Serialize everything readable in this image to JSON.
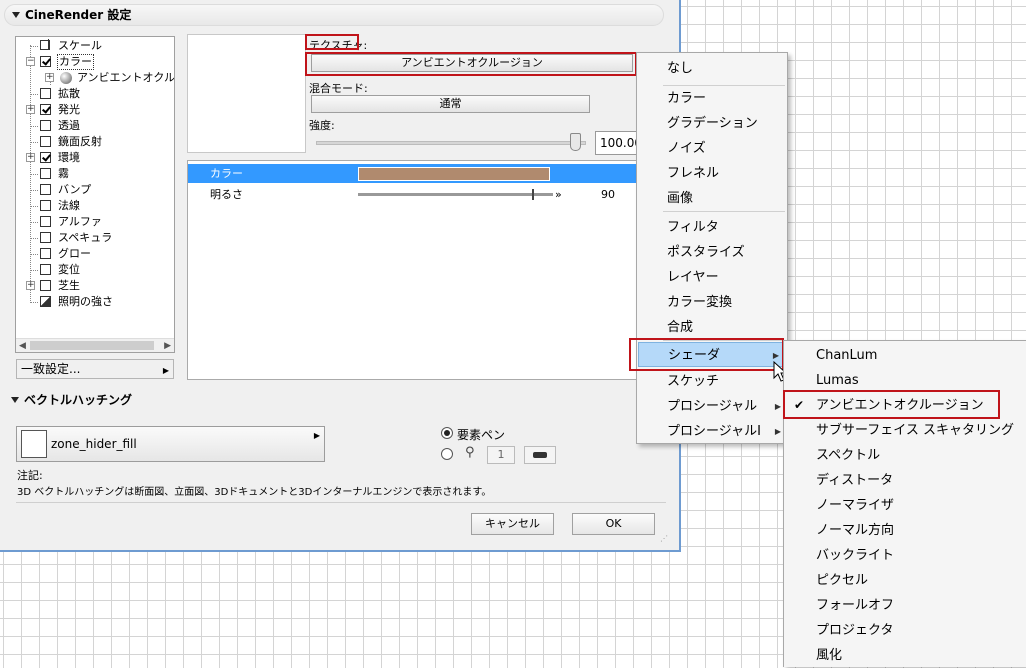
{
  "dialog": {
    "section1_title": "CineRender 設定",
    "tree_items": [
      {
        "label": "スケール",
        "checked": false
      },
      {
        "label": "カラー",
        "checked": true
      },
      {
        "label": "アンビエントオクルージョ"
      },
      {
        "label": "拡散",
        "checked": false
      },
      {
        "label": "発光",
        "checked": true
      },
      {
        "label": "透過",
        "checked": false
      },
      {
        "label": "鏡面反射",
        "checked": false
      },
      {
        "label": "環境",
        "checked": true
      },
      {
        "label": "霧",
        "checked": false
      },
      {
        "label": "バンプ",
        "checked": false
      },
      {
        "label": "法線",
        "checked": false
      },
      {
        "label": "アルファ",
        "checked": false
      },
      {
        "label": "スペキュラ",
        "checked": false
      },
      {
        "label": "グロー",
        "checked": false
      },
      {
        "label": "変位",
        "checked": false
      },
      {
        "label": "芝生",
        "checked": false
      },
      {
        "label": "照明の強さ"
      }
    ],
    "match_settings_label": "一致設定...",
    "texture_label": "テクスチャ:",
    "texture_value": "アンビエントオクルージョン",
    "blend_mode_label": "混合モード:",
    "blend_mode_value": "通常",
    "intensity_label": "強度:",
    "intensity_value": "100.00",
    "intensity_fraction": 1.0,
    "props": [
      {
        "label": "カラー",
        "color": "#b08a6e"
      },
      {
        "label": "明るさ",
        "value": "90"
      }
    ],
    "section2_title": "ベクトルハッチング",
    "surface_name": "zone_hider_fill",
    "pen_radio_label": "要素ペン",
    "pen_number": "1",
    "note_label": "注記:",
    "note_text": "3D ベクトルハッチングは断面図、立面図、3Dドキュメントと3Dインターナルエンジンで表示されます。",
    "cancel_label": "キャンセル",
    "ok_label": "OK"
  },
  "menu": {
    "items": [
      "なし",
      "カラー",
      "グラデーション",
      "ノイズ",
      "フレネル",
      "画像",
      "フィルタ",
      "ポスタライズ",
      "レイヤー",
      "カラー変換",
      "合成",
      "シェーダ",
      "スケッチ",
      "プロシージャル",
      "プロシージャルI"
    ],
    "highlighted": "シェーダ"
  },
  "submenu": {
    "items": [
      "ChanLum",
      "Lumas",
      "アンビエントオクルージョン",
      "サブサーフェイス スキャタリング",
      "スペクトル",
      "ディストータ",
      "ノーマライザ",
      "ノーマル方向",
      "バックライト",
      "ピクセル",
      "フォールオフ",
      "プロジェクタ",
      "風化"
    ],
    "checked": "アンビエントオクルージョン"
  },
  "colors": {
    "selection": "#3399ff",
    "highlight_menu": "#b5d9f9",
    "annotation_red": "#c0141a"
  }
}
